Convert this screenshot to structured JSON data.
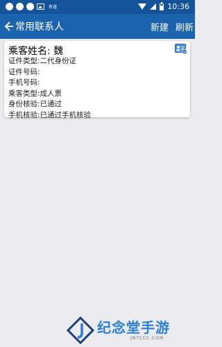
{
  "status_bar": {
    "tiny_label": "有道",
    "time": "10:36"
  },
  "app_bar": {
    "title": "常用联系人",
    "new_label": "新建",
    "refresh_label": "刷新"
  },
  "contact": {
    "name_label": "乘客姓名:",
    "name_value": "魏",
    "rows": [
      {
        "label": "证件类型:",
        "value": "二代身份证"
      },
      {
        "label": "证件号码:",
        "value": ""
      },
      {
        "label": "手机号码:",
        "value": ""
      },
      {
        "label": "乘客类型:",
        "value": "成人票"
      },
      {
        "label": "身份核验:",
        "value": "已通过"
      },
      {
        "label": "手机核验:",
        "value": "已通过手机核验"
      }
    ]
  },
  "watermark": {
    "brand": "纪念堂手游",
    "domain": "JNTCCC.COM"
  },
  "colors": {
    "status_bar": "#14539a",
    "app_bar": "#1c63ad",
    "background": "#ececf0",
    "accent": "#2b7fd6"
  }
}
